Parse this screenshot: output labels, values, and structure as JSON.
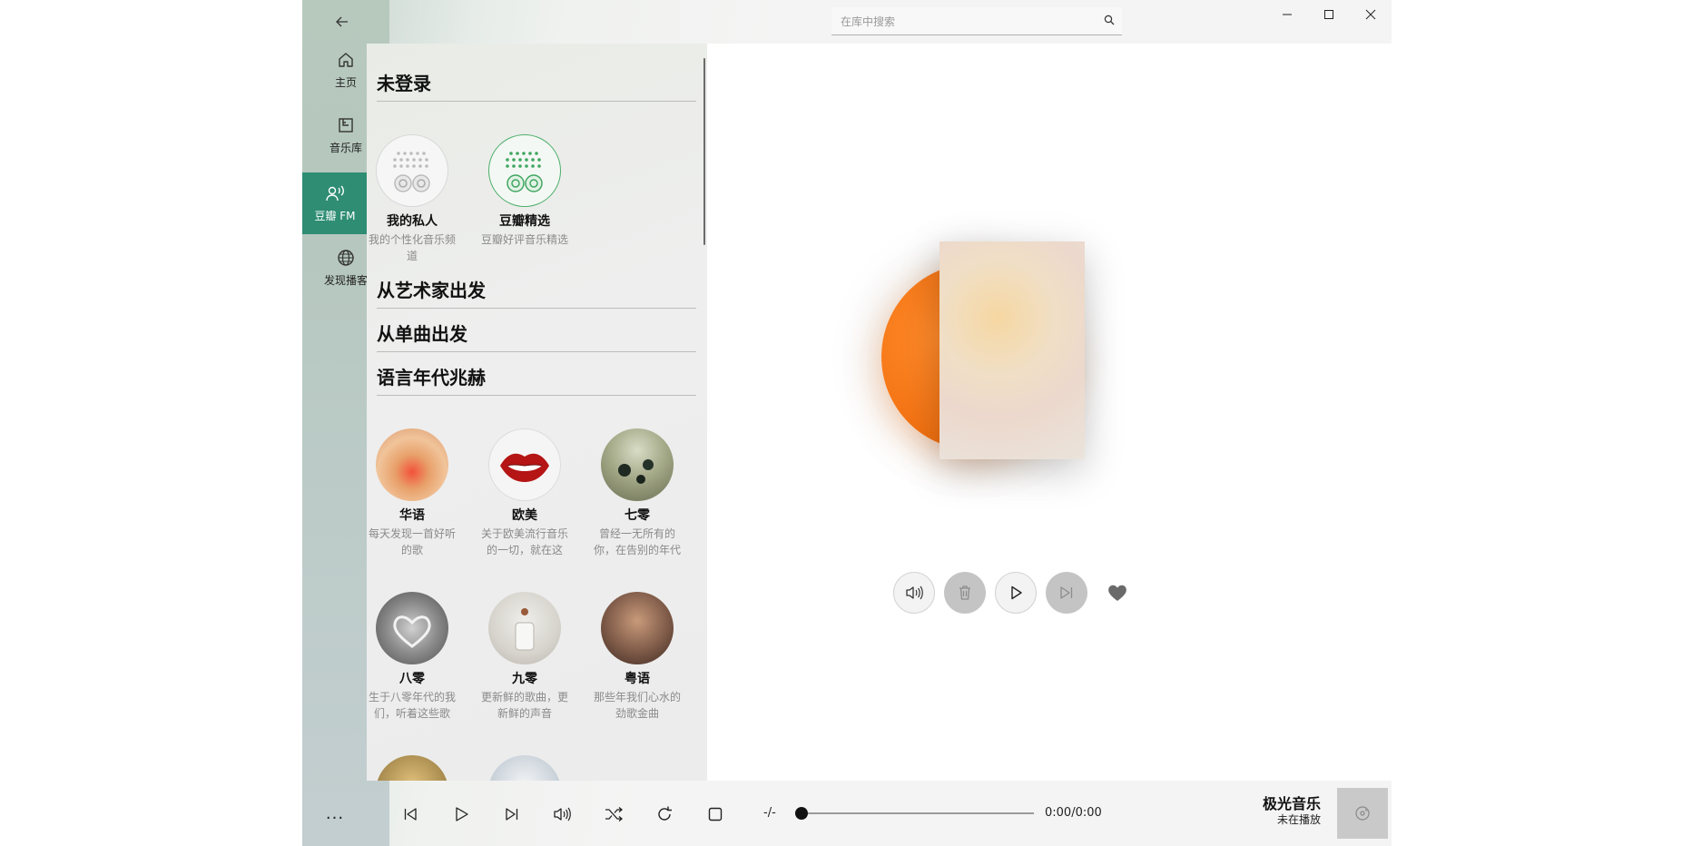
{
  "nav": {
    "items": [
      {
        "label": "主页",
        "icon": "home-icon"
      },
      {
        "label": "音乐库",
        "icon": "library-icon"
      },
      {
        "label": "豆瓣 FM",
        "icon": "radio-icon",
        "active": true
      },
      {
        "label": "发现播客",
        "icon": "globe-icon"
      }
    ],
    "more": "..."
  },
  "search": {
    "placeholder": "在库中搜索"
  },
  "sections": {
    "login": "未登录",
    "artist": "从艺术家出发",
    "single": "从单曲出发",
    "language": "语言年代兆赫"
  },
  "personal": [
    {
      "name": "我的私人",
      "desc": "我的个性化音乐频道"
    },
    {
      "name": "豆瓣精选",
      "desc": "豆瓣好评音乐精选"
    }
  ],
  "channels": [
    {
      "name": "华语",
      "desc": "每天发现一首好听的歌"
    },
    {
      "name": "欧美",
      "desc": "关于欧美流行音乐的一切，就在这"
    },
    {
      "name": "七零",
      "desc": "曾经一无所有的你，在告别的年代"
    },
    {
      "name": "八零",
      "desc": "生于八零年代的我们，听着这些歌"
    },
    {
      "name": "九零",
      "desc": "更新鲜的歌曲，更新鲜的声音"
    },
    {
      "name": "粤语",
      "desc": "那些年我们心水的劲歌金曲"
    }
  ],
  "player": {
    "time_left": "-/-",
    "time_right": "0:00/0:00",
    "app_name": "极光音乐",
    "status": "未在播放",
    "progress": 0
  },
  "colors": {
    "accent": "#2e8d73",
    "disc": "#f27010"
  }
}
